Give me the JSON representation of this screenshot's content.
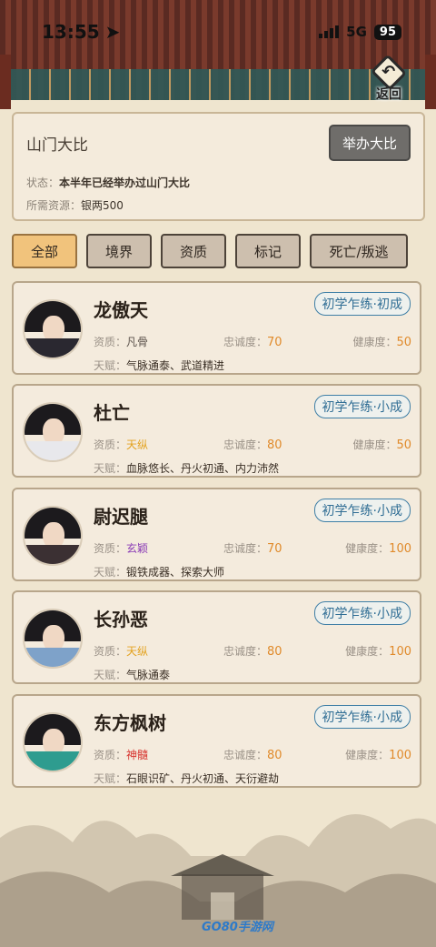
{
  "status_bar": {
    "time": "13:55",
    "network": "5G",
    "battery": "95"
  },
  "nav": {
    "back_label": "返回",
    "back_glyph": "↶"
  },
  "panel": {
    "title": "山门大比",
    "host_button": "举办大比",
    "status_label": "状态：",
    "status_value": "本半年已经举办过山门大比",
    "resource_label": "所需资源：",
    "resource_value": "银两500"
  },
  "tabs": [
    {
      "label": "全部",
      "active": true
    },
    {
      "label": "境界",
      "active": false
    },
    {
      "label": "资质",
      "active": false
    },
    {
      "label": "标记",
      "active": false
    },
    {
      "label": "死亡/叛逃",
      "active": false
    }
  ],
  "field_labels": {
    "aptitude": "资质：",
    "loyalty": "忠诚度：",
    "health": "健康度：",
    "talent": "天赋："
  },
  "disciples": [
    {
      "name": "龙傲天",
      "rank": "初学乍练·初成",
      "aptitude": "凡骨",
      "aptitude_color": "#5a514a",
      "loyalty": "70",
      "health": "50",
      "talent": "气脉通泰、武道精进",
      "robe_color": "#2a2830"
    },
    {
      "name": "杜亡",
      "rank": "初学乍练·小成",
      "aptitude": "天纵",
      "aptitude_color": "#e3a21e",
      "loyalty": "80",
      "health": "50",
      "talent": "血脉悠长、丹火初通、内力沛然",
      "robe_color": "#e8e8ec"
    },
    {
      "name": "尉迟腿",
      "rank": "初学乍练·小成",
      "aptitude": "玄颖",
      "aptitude_color": "#8a3bb5",
      "loyalty": "70",
      "health": "100",
      "talent": "锻铁成器、探索大师",
      "robe_color": "#3b3033"
    },
    {
      "name": "长孙恶",
      "rank": "初学乍练·小成",
      "aptitude": "天纵",
      "aptitude_color": "#e3a21e",
      "loyalty": "80",
      "health": "100",
      "talent": "气脉通泰",
      "robe_color": "#7ea2c9"
    },
    {
      "name": "东方枫树",
      "rank": "初学乍练·小成",
      "aptitude": "神髓",
      "aptitude_color": "#d7332e",
      "loyalty": "80",
      "health": "100",
      "talent": "石眼识矿、丹火初通、天衍避劫",
      "robe_color": "#2e9c8f"
    }
  ],
  "watermark": "GO80手游网"
}
